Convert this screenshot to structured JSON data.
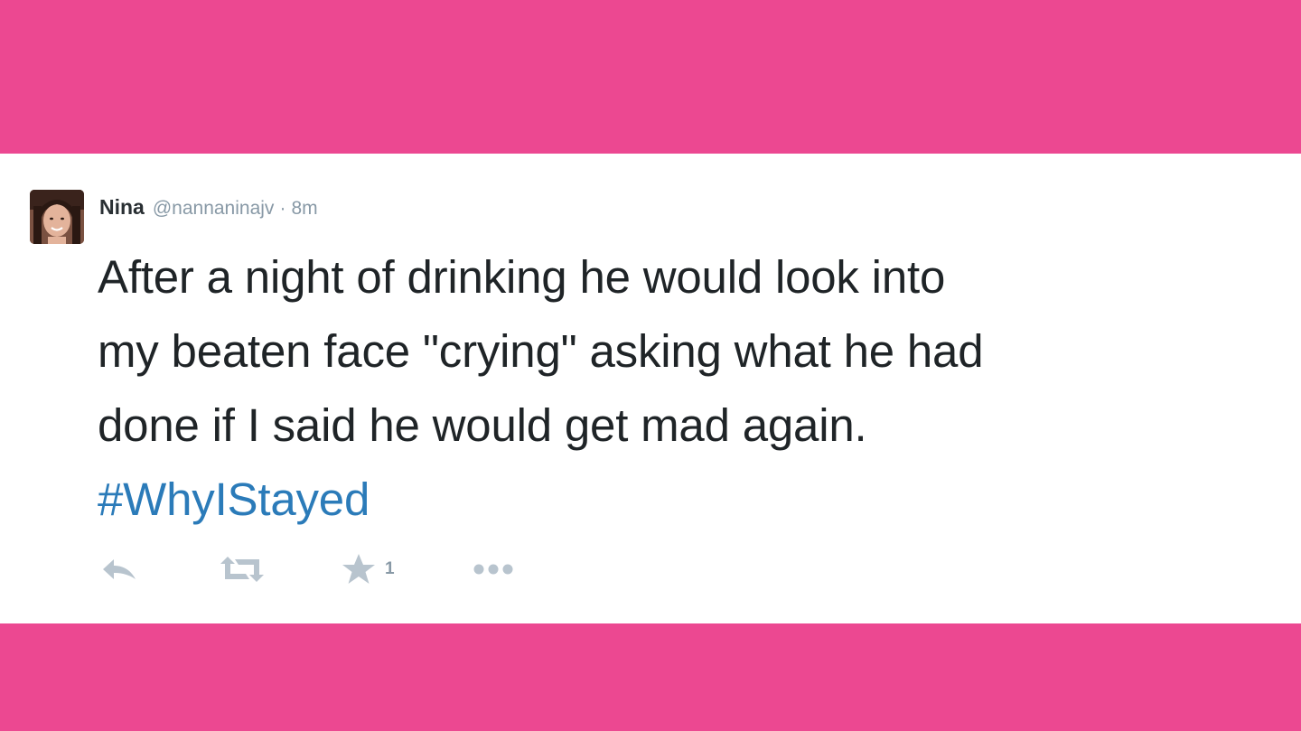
{
  "tweet": {
    "author_name": "Nina",
    "author_handle": "@nannaninajv",
    "separator": "·",
    "timestamp": "8m",
    "text_line_1": "After a night of drinking he would look into",
    "text_line_2": "my beaten face \"crying\" asking what he had",
    "text_line_3": "done if I said he would get mad again.",
    "hashtag": "#WhyIStayed",
    "favorite_count": "1"
  },
  "colors": {
    "background_pink": "#ec4891",
    "card": "#ffffff",
    "text": "#1f2427",
    "hashtag": "#2b7bb9",
    "muted": "#8899a6"
  },
  "icons": {
    "reply": "reply-icon",
    "retweet": "retweet-icon",
    "favorite": "star-icon",
    "more": "more-dots-icon"
  }
}
